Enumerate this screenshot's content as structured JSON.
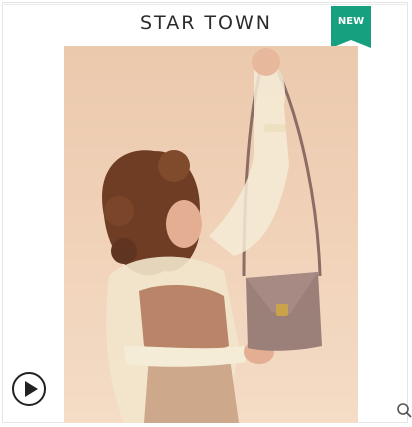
{
  "header": {
    "brand": "STAR TOWN",
    "badge": "NEW"
  },
  "colors": {
    "badge": "#16a07f",
    "background": "#f1d3ba",
    "bag": "#9b7f79"
  },
  "icons": {
    "play": "play-circle-icon",
    "zoom": "magnifier-icon"
  }
}
